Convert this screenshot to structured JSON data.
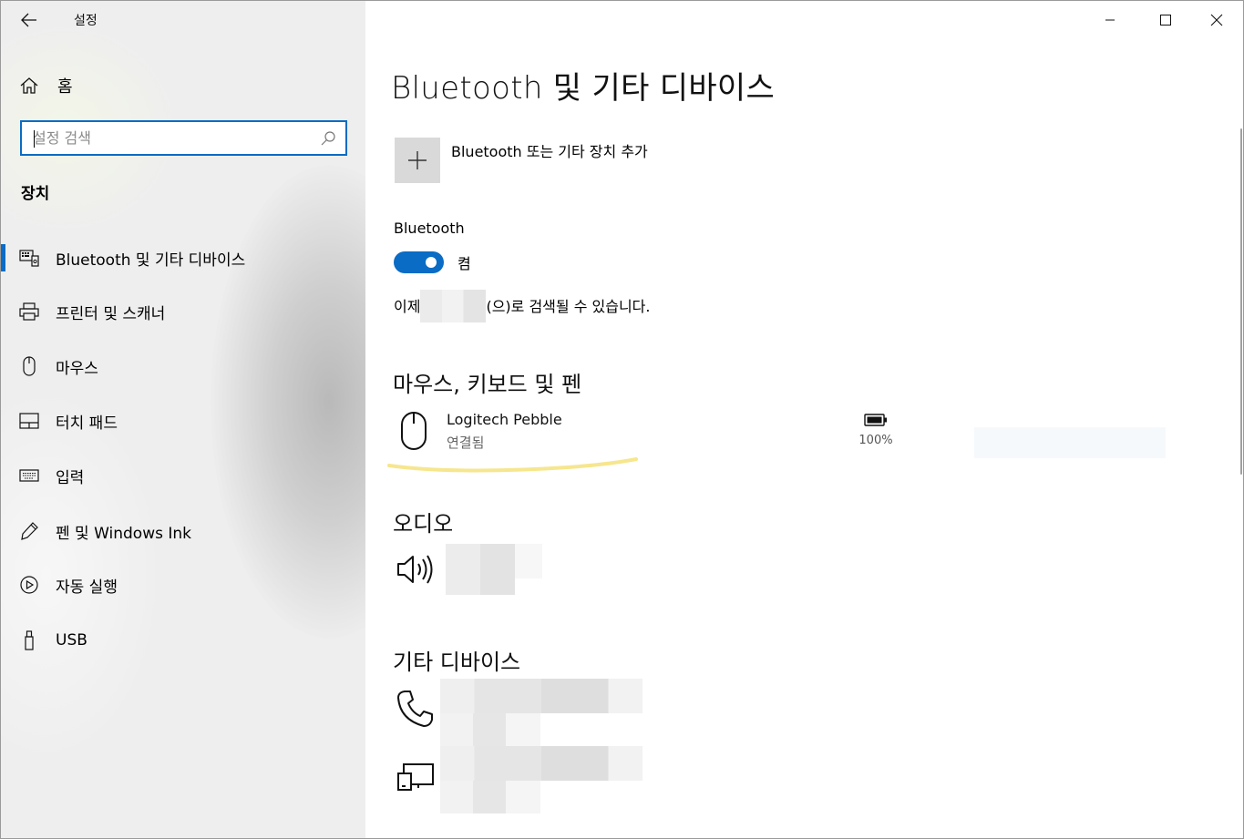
{
  "app": {
    "title": "설정"
  },
  "sidebar": {
    "home_label": "홈",
    "search_placeholder": "설정 검색",
    "section": "장치",
    "items": [
      {
        "label": "Bluetooth 및 기타 디바이스",
        "icon": "bluetooth-devices-icon",
        "active": true
      },
      {
        "label": "프린터 및 스캐너",
        "icon": "printer-icon"
      },
      {
        "label": "마우스",
        "icon": "mouse-icon"
      },
      {
        "label": "터치 패드",
        "icon": "touchpad-icon"
      },
      {
        "label": "입력",
        "icon": "keyboard-icon"
      },
      {
        "label": "펜 및 Windows Ink",
        "icon": "pen-icon"
      },
      {
        "label": "자동 실행",
        "icon": "autoplay-icon"
      },
      {
        "label": "USB",
        "icon": "usb-icon"
      }
    ]
  },
  "main": {
    "title": "Bluetooth 및 기타 디바이스",
    "add_device_label": "Bluetooth 또는 기타 장치 추가",
    "bluetooth_label": "Bluetooth",
    "toggle_state": "켬",
    "toggle_on": true,
    "discoverable_prefix": "이제",
    "discoverable_suffix": "(으)로 검색될 수 있습니다.",
    "groups": {
      "input": {
        "heading": "마우스, 키보드 및 펜",
        "device_name": "Logitech Pebble",
        "device_status": "연결됨",
        "battery_percent": "100%"
      },
      "audio": {
        "heading": "오디오"
      },
      "other": {
        "heading": "기타 디바이스"
      }
    }
  },
  "colors": {
    "accent": "#0a6cc4",
    "sidebar_bg": "#eeeeee",
    "highlight": "#f5e27a"
  }
}
